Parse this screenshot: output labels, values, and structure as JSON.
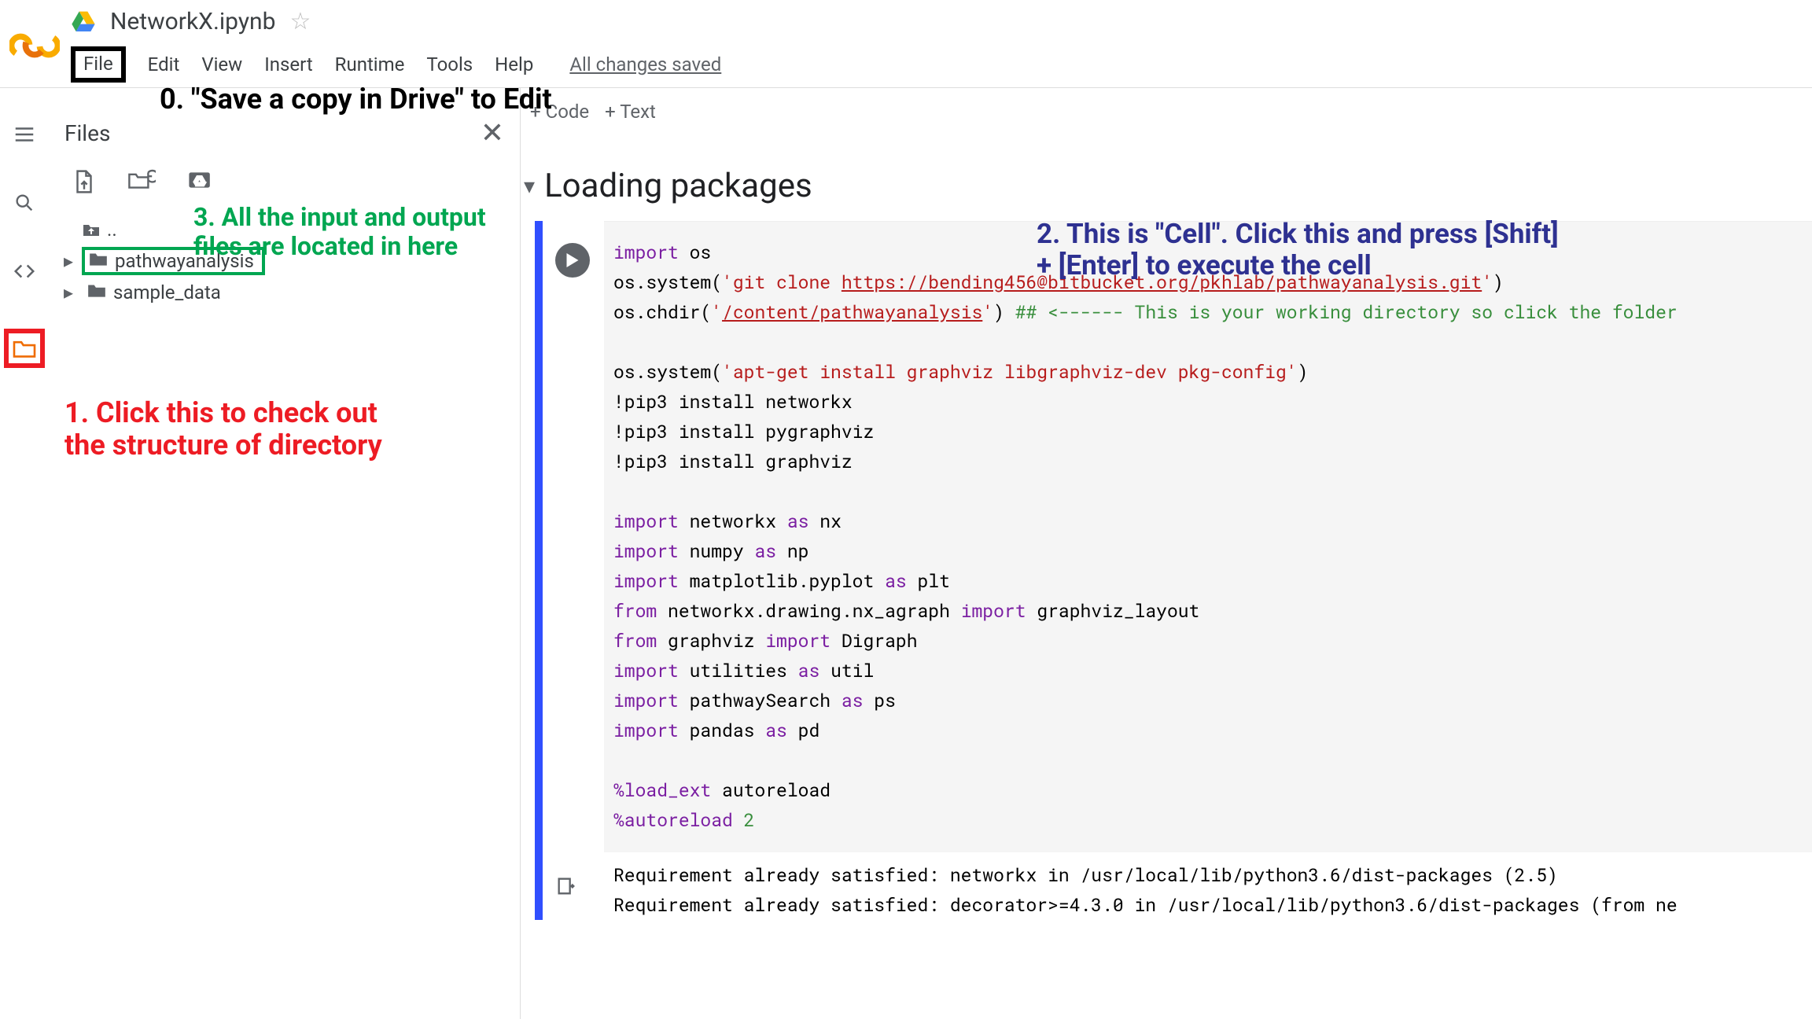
{
  "header": {
    "notebook_title": "NetworkX.ipynb",
    "menus": [
      "File",
      "Edit",
      "View",
      "Insert",
      "Runtime",
      "Tools",
      "Help"
    ],
    "saved_status": "All changes saved"
  },
  "sidebar": {
    "title": "Files",
    "parent_label": "..",
    "folders": [
      {
        "name": "pathwayanalysis"
      },
      {
        "name": "sample_data"
      }
    ]
  },
  "toolbar": {
    "code_label": "+ Code",
    "text_label": "+ Text"
  },
  "section": {
    "title": "Loading packages"
  },
  "annotations": {
    "a0": "0. \"Save a copy in Drive\" to Edit",
    "a1": "1. Click this to check out\nthe structure of directory",
    "a2": "2. This is \"Cell\". Click this and press [Shift]\n+ [Enter] to execute the cell",
    "a3": "3. All the input and output\nfiles are located in here"
  },
  "code": {
    "l01a": "import",
    "l01b": " os",
    "l02a": "os.system(",
    "l02b": "'git clone ",
    "l02c": "https://bending456@bitbucket.org/pkhlab/pathwayanalysis.git",
    "l02d": "'",
    "l02e": ")",
    "l03a": "os.chdir(",
    "l03b": "'",
    "l03c": "/content/pathwayanalysis",
    "l03d": "'",
    "l03e": ") ",
    "l03f": "## <------ This is your working directory so click the folder",
    "l05a": "os.system(",
    "l05b": "'apt-get install graphviz libgraphviz-dev pkg-config'",
    "l05c": ")",
    "l06": "!pip3 install networkx",
    "l07": "!pip3 install pygraphviz",
    "l08": "!pip3 install graphviz",
    "l10a": "import",
    "l10b": " networkx ",
    "l10c": "as",
    "l10d": " nx",
    "l11a": "import",
    "l11b": " numpy ",
    "l11c": "as",
    "l11d": " np",
    "l12a": "import",
    "l12b": " matplotlib.pyplot ",
    "l12c": "as",
    "l12d": " plt",
    "l13a": "from",
    "l13b": " networkx.drawing.nx_agraph ",
    "l13c": "import",
    "l13d": " graphviz_layout",
    "l14a": "from",
    "l14b": " graphviz ",
    "l14c": "import",
    "l14d": " Digraph",
    "l15a": "import",
    "l15b": " utilities ",
    "l15c": "as",
    "l15d": " util",
    "l16a": "import",
    "l16b": " pathwaySearch ",
    "l16c": "as",
    "l16d": " ps",
    "l17a": "import",
    "l17b": " pandas ",
    "l17c": "as",
    "l17d": " pd",
    "l19a": "%load_ext",
    "l19b": " autoreload",
    "l20a": "%autoreload ",
    "l20b": "2"
  },
  "output": {
    "o1": "Requirement already satisfied: networkx in /usr/local/lib/python3.6/dist-packages (2.5)",
    "o2": "Requirement already satisfied: decorator>=4.3.0 in /usr/local/lib/python3.6/dist-packages (from ne"
  }
}
